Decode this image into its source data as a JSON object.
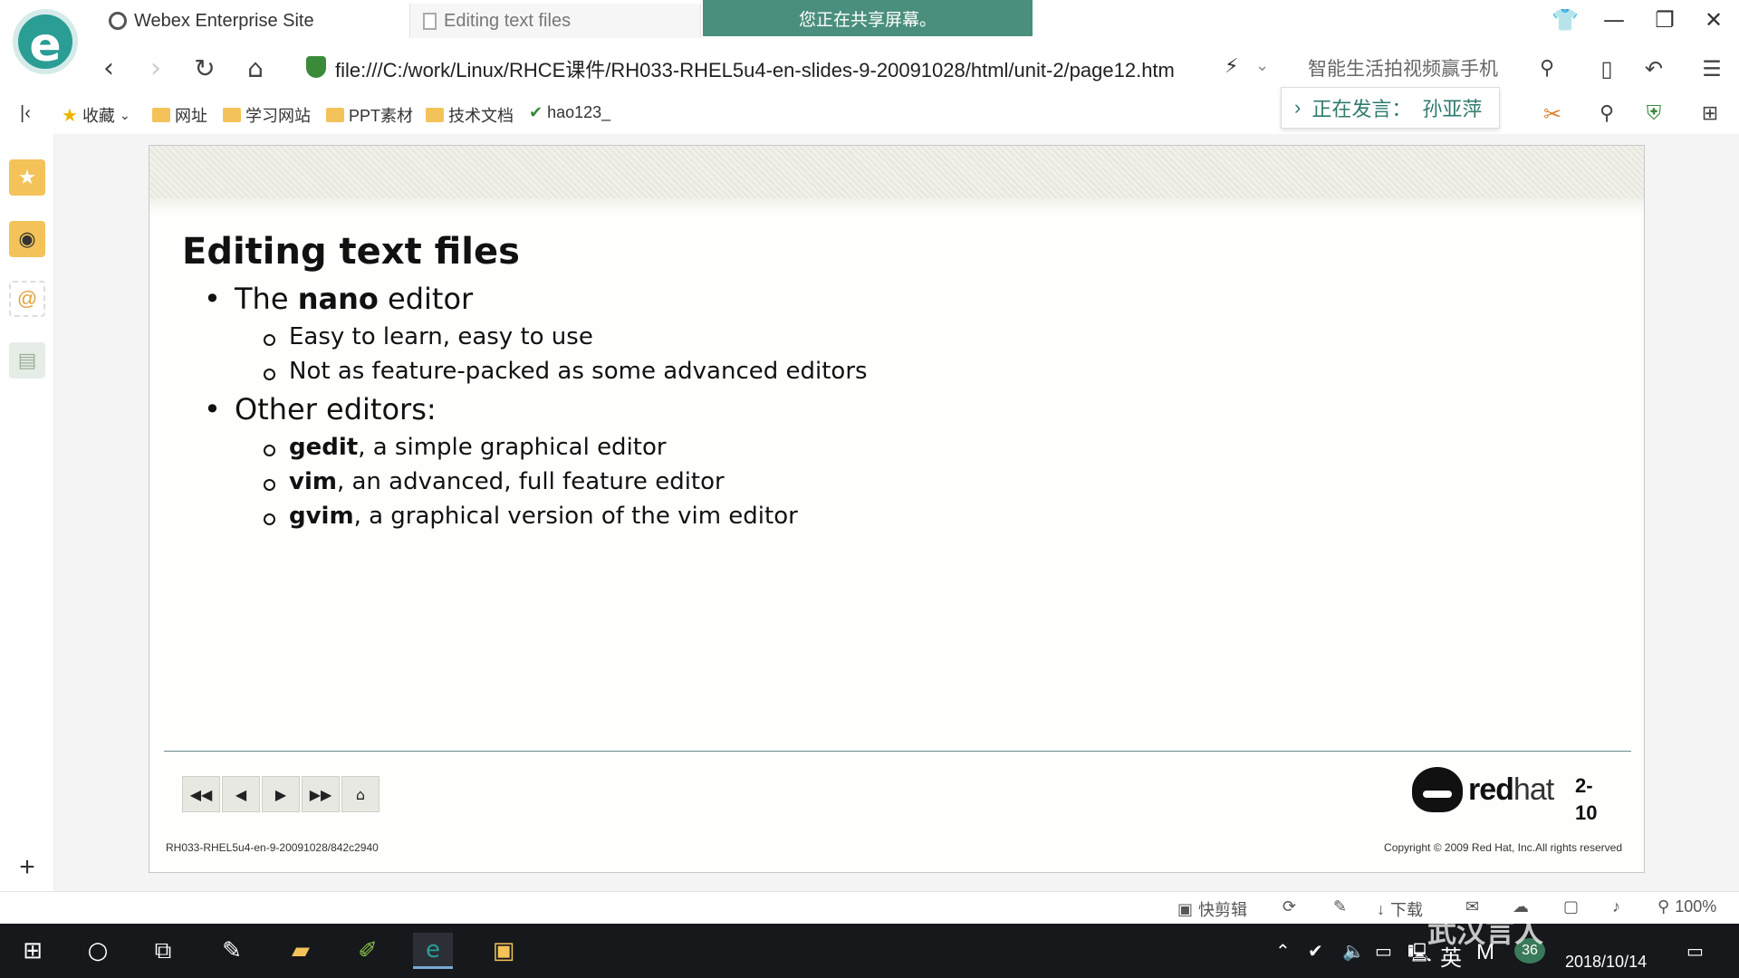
{
  "tabs": [
    {
      "label": "Webex Enterprise Site"
    },
    {
      "label": "Editing text files"
    }
  ],
  "share_banner": "您正在共享屏幕。",
  "address": {
    "url": "file:///C:/work/Linux/RHCE课件/RH033-RHEL5u4-en-slides-9-20091028/html/unit-2/page12.htm",
    "search_promo": "智能生活拍视频赢手机"
  },
  "bookmarks": [
    {
      "label": "收藏"
    },
    {
      "label": "网址"
    },
    {
      "label": "学习网站"
    },
    {
      "label": "PPT素材"
    },
    {
      "label": "技术文档"
    },
    {
      "label": "hao123_"
    }
  ],
  "speaking": {
    "label": "正在发言：",
    "name": "孙亚萍"
  },
  "slide": {
    "title": "Editing text files",
    "bullets": [
      {
        "pre": "The ",
        "bold": "nano",
        "post": " editor"
      },
      {
        "text": "Easy to learn, easy to use"
      },
      {
        "text": "Not as feature-packed as some advanced editors"
      },
      {
        "text": "Other editors:"
      },
      {
        "bold": "gedit",
        "post": ", a simple graphical editor"
      },
      {
        "bold": "vim",
        "post": ", an advanced, full feature editor"
      },
      {
        "bold": "gvim",
        "post": ", a graphical version of the vim editor"
      }
    ],
    "slide_id": "RH033-RHEL5u4-en-9-20091028/842c2940",
    "copyright": "Copyright © 2009 Red Hat, Inc.All rights reserved",
    "logo_text_bold": "red",
    "logo_text_light": "hat",
    "page_top": "2-",
    "page_bottom": "10"
  },
  "status": {
    "quick_edit": "快剪辑",
    "download": "下载",
    "zoom": "100%"
  },
  "taskbar": {
    "ime": "英",
    "badge": "36",
    "date": "2018/10/14",
    "watermark": "武汉言人"
  },
  "colors": {
    "share_banner": "#4a8f7d",
    "browser_accent": "#2a9d95",
    "taskbar": "#16181b"
  }
}
